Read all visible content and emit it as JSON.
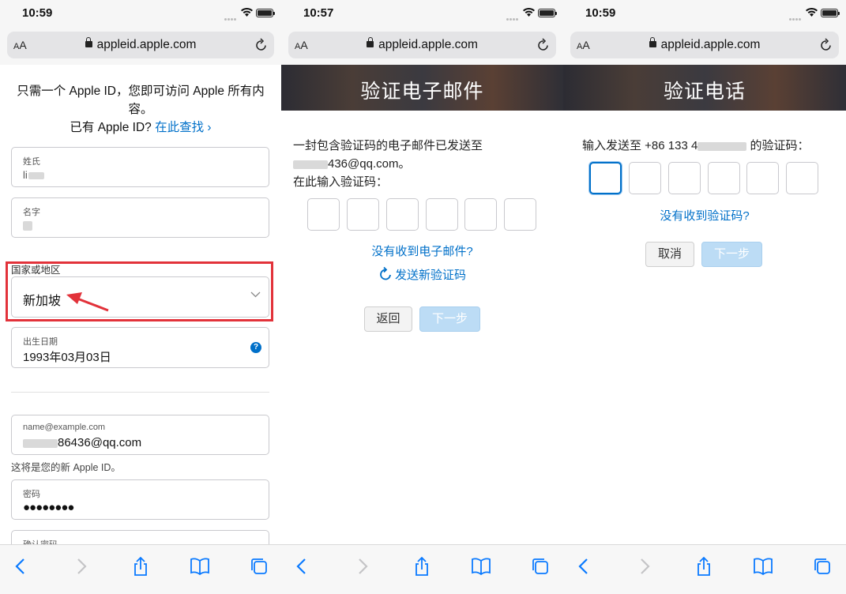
{
  "screens": [
    {
      "status_time": "10:59",
      "url": "appleid.apple.com",
      "url_text_size": "AA",
      "intro_line1": "只需一个 Apple ID，您即可访问 Apple 所有内",
      "intro_line2": "容。",
      "have_id_text": "已有 Apple ID?",
      "find_link": "在此查找 ›",
      "last_name_label": "姓氏",
      "last_name_value": "li",
      "first_name_label": "名字",
      "country_section_label": "国家或地区",
      "country_value": "新加坡",
      "birth_label": "出生日期",
      "birth_value": "1993年03月03日",
      "email_placeholder": "name@example.com",
      "email_value": "86436@qq.com",
      "new_id_note": "这将是您的新 Apple ID。",
      "password_label": "密码",
      "password_value": "●●●●●●●●",
      "confirm_password_label": "确认密码"
    },
    {
      "status_time": "10:57",
      "url": "appleid.apple.com",
      "url_text_size": "AA",
      "banner_title": "验证电子邮件",
      "sent_line1": "一封包含验证码的电子邮件已发送至",
      "sent_line2": "436@qq.com。",
      "enter_code": "在此输入验证码：",
      "no_email_link": "没有收到电子邮件?",
      "resend_link": "发送新验证码",
      "back_button": "返回",
      "next_button": "下一步"
    },
    {
      "status_time": "10:59",
      "url": "appleid.apple.com",
      "url_text_size": "AA",
      "banner_title": "验证电话",
      "sent_prefix": "输入发送至 +86 133 4",
      "sent_suffix": " 的验证码：",
      "no_code_link": "没有收到验证码?",
      "cancel_button": "取消",
      "next_button": "下一步"
    }
  ],
  "colors": {
    "link": "#0070c9",
    "highlight_box": "#e2323a",
    "primary_disabled": "#bcdcf5"
  },
  "icons": [
    "lock-icon",
    "reload-icon",
    "back-icon",
    "forward-icon",
    "share-icon",
    "bookmarks-icon",
    "tabs-icon",
    "chevron-down-icon",
    "help-icon",
    "refresh-icon",
    "arrow-icon"
  ]
}
